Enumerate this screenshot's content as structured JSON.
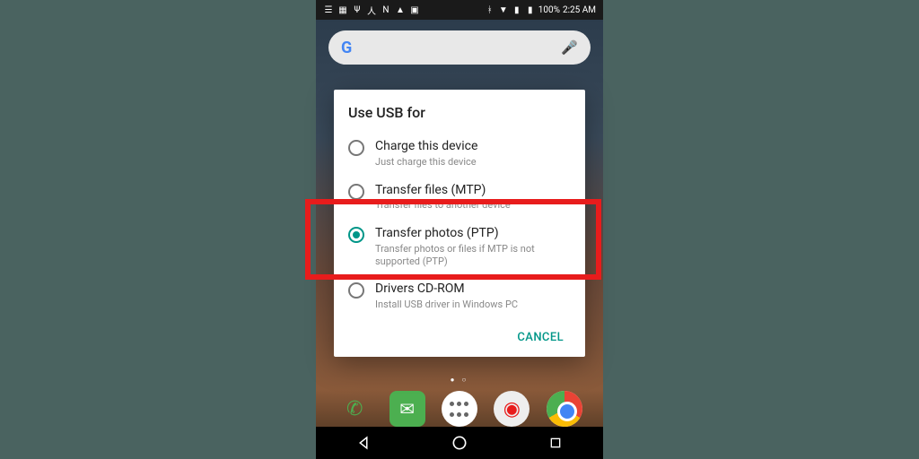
{
  "status": {
    "battery_pct": "100%",
    "time": "2:25 AM"
  },
  "dialog": {
    "title": "Use USB for",
    "options": [
      {
        "label": "Charge this device",
        "sub": "Just charge this device",
        "selected": false
      },
      {
        "label": "Transfer files (MTP)",
        "sub": "Transfer files to another device",
        "selected": false
      },
      {
        "label": "Transfer photos (PTP)",
        "sub": "Transfer photos or files if MTP is not supported (PTP)",
        "selected": true
      },
      {
        "label": "Drivers CD-ROM",
        "sub": "Install USB driver in Windows PC",
        "selected": false
      }
    ],
    "cancel": "CANCEL"
  },
  "highlighted_index": 2
}
